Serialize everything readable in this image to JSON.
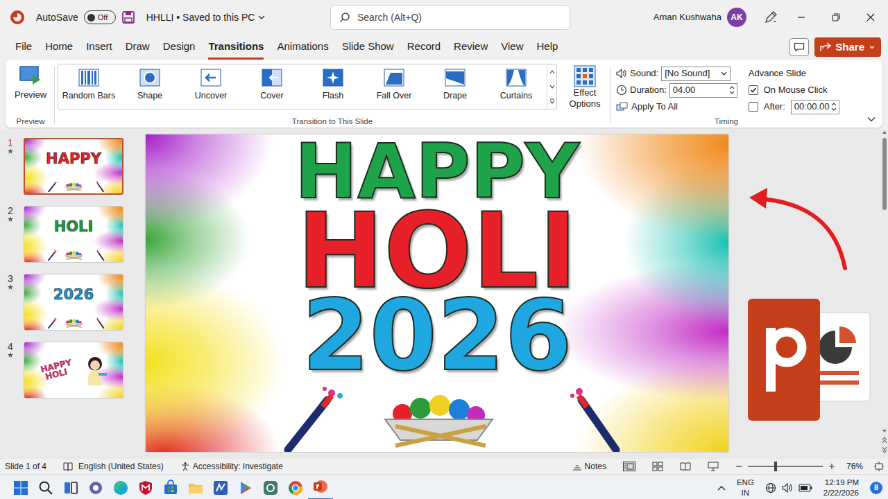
{
  "title_bar": {
    "autosave": "AutoSave",
    "autosave_state": "Off",
    "autosave_on": false,
    "document": "HHLLI • Saved to this PC",
    "search": "Search (Alt+Q)",
    "user_name": "Aman Kushwaha",
    "user_initials": "AK"
  },
  "menu_tabs": [
    {
      "label": "File",
      "selected": false
    },
    {
      "label": "Home",
      "selected": false
    },
    {
      "label": "Insert",
      "selected": false
    },
    {
      "label": "Draw",
      "selected": false
    },
    {
      "label": "Design",
      "selected": false
    },
    {
      "label": "Transitions",
      "selected": true
    },
    {
      "label": "Animations",
      "selected": false
    },
    {
      "label": "Slide Show",
      "selected": false
    },
    {
      "label": "Record",
      "selected": false
    },
    {
      "label": "Review",
      "selected": false
    },
    {
      "label": "View",
      "selected": false
    },
    {
      "label": "Help",
      "selected": false
    }
  ],
  "share": "Share",
  "ribbon": {
    "preview": "Preview",
    "preview_group": "Preview",
    "transitions": [
      {
        "label": "Random Bars"
      },
      {
        "label": "Shape"
      },
      {
        "label": "Uncover"
      },
      {
        "label": "Cover"
      },
      {
        "label": "Flash"
      },
      {
        "label": "Fall Over"
      },
      {
        "label": "Drape"
      },
      {
        "label": "Curtains"
      }
    ],
    "transitions_group": "Transition to This Slide",
    "effect_options": "Effect Options",
    "timing": {
      "sound_label": "Sound:",
      "sound_value": "[No Sound]",
      "duration_label": "Duration:",
      "duration_value": "04.00",
      "apply_all": "Apply To All",
      "advance_title": "Advance Slide",
      "on_click": {
        "label": "On Mouse Click",
        "checked": true
      },
      "after": {
        "label": "After:",
        "checked": false,
        "value": "00:00.00"
      },
      "group": "Timing"
    }
  },
  "slides": [
    {
      "number": "1",
      "selected": true,
      "thumb_lines": [
        {
          "text": "HAPPY",
          "color": "#e4202a"
        }
      ]
    },
    {
      "number": "2",
      "selected": false,
      "thumb_lines": [
        {
          "text": "HOLI",
          "color": "#1a9a40"
        }
      ]
    },
    {
      "number": "3",
      "selected": false,
      "thumb_lines": [
        {
          "text": "2026",
          "color": "#1e96d6"
        }
      ]
    },
    {
      "number": "4",
      "selected": false,
      "thumb_lines": [
        {
          "text": "HAPPY",
          "color": "#d6336c"
        },
        {
          "text": "HOLI",
          "color": "#d6336c"
        }
      ]
    }
  ],
  "slide_canvas": {
    "lines": [
      {
        "text": "HAPPY",
        "color": "#1fa34a"
      },
      {
        "text": "HOLI",
        "color": "#e8202a"
      },
      {
        "text": "2026",
        "color": "#1ea7e1"
      }
    ]
  },
  "status_bar": {
    "slide": "Slide 1 of 4",
    "language": "English (United States)",
    "accessibility": "Accessibility: Investigate",
    "notes": "Notes",
    "zoom": "76%",
    "zoom_level": 0.37
  },
  "taskbar": {
    "language": "ENG",
    "region": "IN",
    "time": "12:19 PM",
    "date": "2/22/2026",
    "notifications": "8"
  }
}
